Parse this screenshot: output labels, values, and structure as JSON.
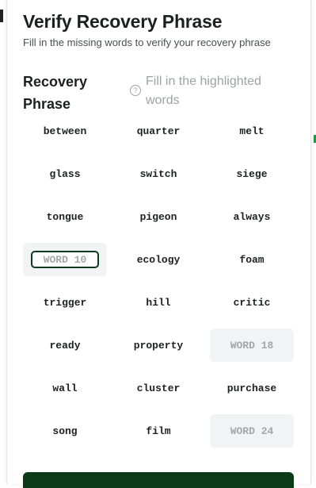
{
  "dialog": {
    "title": "Verify Recovery Phrase",
    "subtitle": "Fill in the missing words to verify your recovery phrase",
    "section_label": "Recovery Phrase",
    "hint_icon": "question-circle-icon",
    "hint": "Fill in the highlighted words"
  },
  "words": [
    {
      "text": "between"
    },
    {
      "text": "quarter"
    },
    {
      "text": "melt"
    },
    {
      "text": "glass"
    },
    {
      "text": "switch"
    },
    {
      "text": "siege"
    },
    {
      "text": "tongue"
    },
    {
      "text": "pigeon"
    },
    {
      "text": "always"
    },
    {
      "placeholder": "WORD 10",
      "input": true
    },
    {
      "text": "ecology"
    },
    {
      "text": "foam"
    },
    {
      "text": "trigger"
    },
    {
      "text": "hill"
    },
    {
      "text": "critic"
    },
    {
      "text": "ready"
    },
    {
      "text": "property"
    },
    {
      "placeholder": "WORD 18"
    },
    {
      "text": "wall"
    },
    {
      "text": "cluster"
    },
    {
      "text": "purchase"
    },
    {
      "text": "song"
    },
    {
      "text": "film"
    },
    {
      "placeholder": "WORD 24"
    }
  ],
  "colors": {
    "accent": "#0b3a16",
    "hint": "#9ea1a6",
    "blank_bg": "#f2f3f4"
  }
}
